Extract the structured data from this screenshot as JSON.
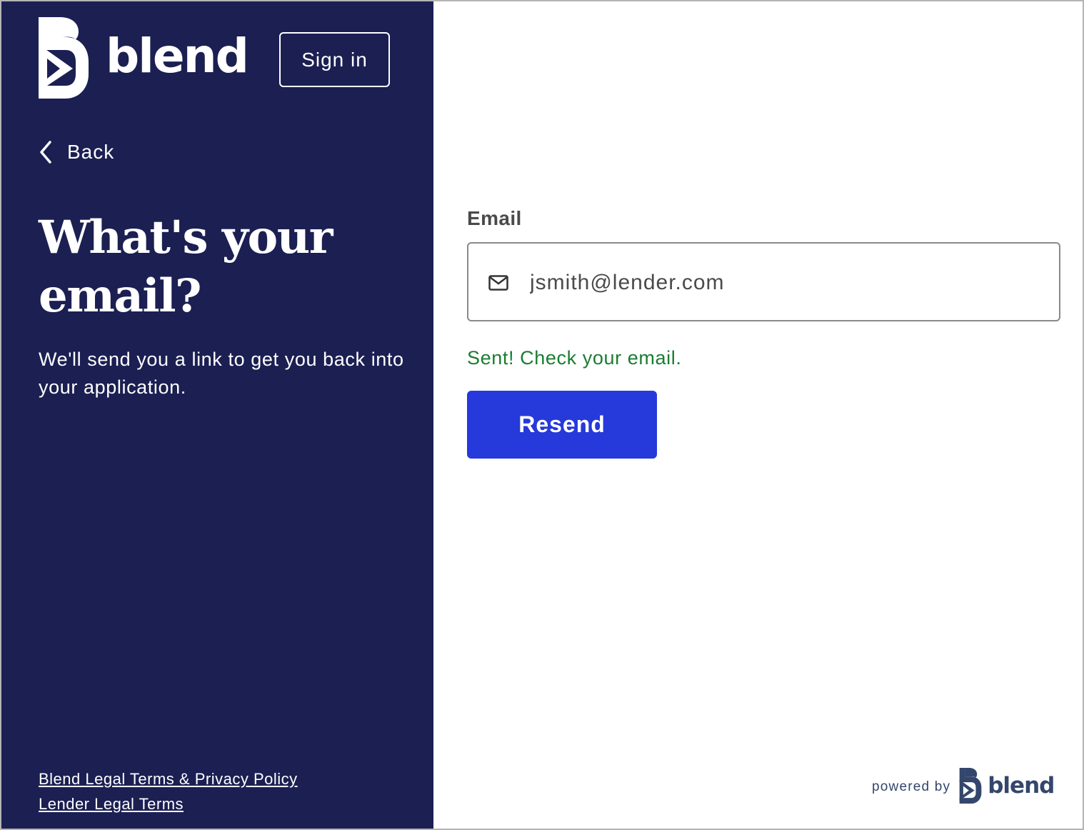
{
  "brand": {
    "name": "blend",
    "colors": {
      "panel": "#1b1f52",
      "primary_button": "#2639db",
      "success_text": "#1a7d32",
      "footer_brand": "#34466b"
    }
  },
  "header": {
    "sign_in_label": "Sign in"
  },
  "nav": {
    "back_label": "Back",
    "back_icon": "chevron-left-icon"
  },
  "intro": {
    "heading": "What's your email?",
    "description": "We'll send you a link to get you back into your application."
  },
  "legal": {
    "links": [
      "Blend Legal Terms & Privacy Policy",
      "Lender Legal Terms"
    ]
  },
  "form": {
    "email_label": "Email",
    "email_value": "jsmith@lender.com",
    "email_icon": "mail-icon",
    "status_message": "Sent! Check your email.",
    "resend_label": "Resend"
  },
  "footer": {
    "powered_by": "powered by",
    "brand_word": "blend"
  }
}
